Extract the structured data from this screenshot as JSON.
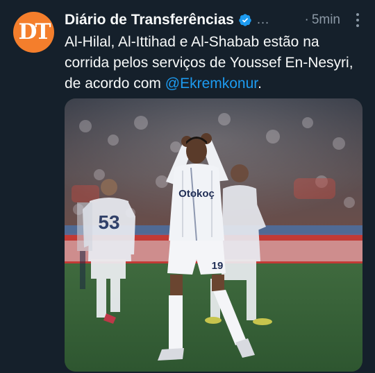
{
  "tweet": {
    "avatar_icon": "dt-logo-icon",
    "display_name": "Diário de Transferências",
    "verified_icon": "verified-badge-icon",
    "handle": "…",
    "separator": "·",
    "time": "5min",
    "more_icon": "more-options-icon",
    "text_before": "Al-Hilal, Al-Ittihad e Al-Shabab estão na corrida pelos serviços de Youssef En-Nesyri, de acordo com ",
    "mention": "@Ekremkonur",
    "text_after": ".",
    "media": {
      "player_main_number": "19",
      "player_left_number": "53",
      "sponsor_text": "Otokoç",
      "colors": {
        "accent": "#1d9bf0",
        "avatar_bg": "#f47e2c",
        "background": "#15202b"
      }
    }
  }
}
